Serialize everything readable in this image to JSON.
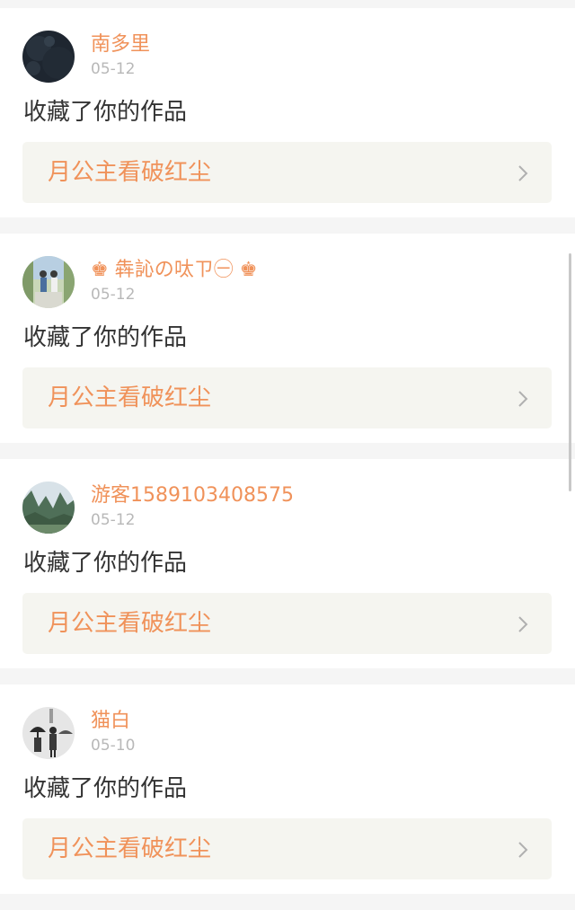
{
  "notifications": [
    {
      "username": "南多里",
      "date": "05-12",
      "action": "收藏了你的作品",
      "work_title": "月公主看破红尘",
      "avatar_icon": "dark-texture-avatar-icon"
    },
    {
      "username": "♚ 犇訫の呔ㄗ㊀ ♚",
      "date": "05-12",
      "action": "收藏了你的作品",
      "work_title": "月公主看破红尘",
      "avatar_icon": "couple-photo-avatar-icon"
    },
    {
      "username": "游客1589103408575",
      "date": "05-12",
      "action": "收藏了你的作品",
      "work_title": "月公主看破红尘",
      "avatar_icon": "mountain-landscape-avatar-icon"
    },
    {
      "username": "猫白",
      "date": "05-10",
      "action": "收藏了你的作品",
      "work_title": "月公主看破红尘",
      "avatar_icon": "people-umbrella-avatar-icon"
    }
  ],
  "colors": {
    "accent": "#f0925a",
    "date": "#b8b8b8",
    "text": "#333333",
    "work_box_bg": "#f5f5f0",
    "page_bg": "#f5f5f5"
  },
  "icons": {
    "chevron": "chevron-right-icon"
  }
}
